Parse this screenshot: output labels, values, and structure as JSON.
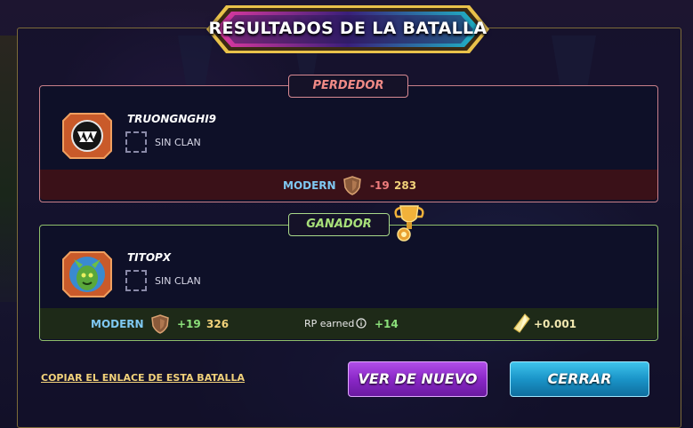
{
  "title": "RESULTADOS DE LA BATALLA",
  "loser": {
    "tag": "PERDEDOR",
    "player": "TRUONGNGHI9",
    "clan": "SIN CLAN",
    "format": "MODERN",
    "rating_change": "-19",
    "rating": "283"
  },
  "winner": {
    "tag": "GANADOR",
    "player": "TITOPX",
    "clan": "SIN CLAN",
    "format": "MODERN",
    "rating_change": "+19",
    "rating": "326",
    "rp_label": "RP earned",
    "rp_value": "+14",
    "reward_value": "+0.001"
  },
  "copy_link": "COPIAR EL ENLACE DE ESTA BATALLA",
  "buttons": {
    "again": "VER DE NUEVO",
    "close": "CERRAR"
  },
  "colors": {
    "loser_accent": "#f08a86",
    "winner_accent": "#a8e07a",
    "modern": "#7fc8f2",
    "rating": "#f2d27a",
    "again_button": "#8a27c7",
    "close_button": "#1a94c8"
  },
  "icons": {
    "loser_avatar": "fanged-monster-icon",
    "winner_avatar": "cactus-creature-icon",
    "league": "bronze-shield-icon",
    "trophy": "trophy-icon",
    "info": "info-icon",
    "reward": "crystal-shard-icon"
  }
}
